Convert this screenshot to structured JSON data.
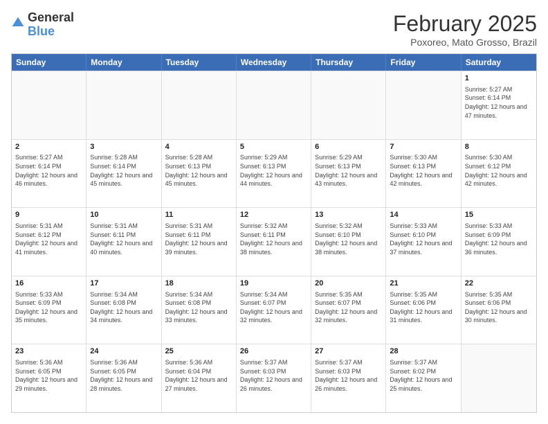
{
  "header": {
    "logo_general": "General",
    "logo_blue": "Blue",
    "month_title": "February 2025",
    "subtitle": "Poxoreo, Mato Grosso, Brazil"
  },
  "weekdays": [
    "Sunday",
    "Monday",
    "Tuesday",
    "Wednesday",
    "Thursday",
    "Friday",
    "Saturday"
  ],
  "rows": [
    [
      {
        "day": "",
        "info": "",
        "empty": true
      },
      {
        "day": "",
        "info": "",
        "empty": true
      },
      {
        "day": "",
        "info": "",
        "empty": true
      },
      {
        "day": "",
        "info": "",
        "empty": true
      },
      {
        "day": "",
        "info": "",
        "empty": true
      },
      {
        "day": "",
        "info": "",
        "empty": true
      },
      {
        "day": "1",
        "info": "Sunrise: 5:27 AM\nSunset: 6:14 PM\nDaylight: 12 hours\nand 47 minutes.",
        "empty": false
      }
    ],
    [
      {
        "day": "2",
        "info": "Sunrise: 5:27 AM\nSunset: 6:14 PM\nDaylight: 12 hours\nand 46 minutes.",
        "empty": false
      },
      {
        "day": "3",
        "info": "Sunrise: 5:28 AM\nSunset: 6:14 PM\nDaylight: 12 hours\nand 45 minutes.",
        "empty": false
      },
      {
        "day": "4",
        "info": "Sunrise: 5:28 AM\nSunset: 6:13 PM\nDaylight: 12 hours\nand 45 minutes.",
        "empty": false
      },
      {
        "day": "5",
        "info": "Sunrise: 5:29 AM\nSunset: 6:13 PM\nDaylight: 12 hours\nand 44 minutes.",
        "empty": false
      },
      {
        "day": "6",
        "info": "Sunrise: 5:29 AM\nSunset: 6:13 PM\nDaylight: 12 hours\nand 43 minutes.",
        "empty": false
      },
      {
        "day": "7",
        "info": "Sunrise: 5:30 AM\nSunset: 6:13 PM\nDaylight: 12 hours\nand 42 minutes.",
        "empty": false
      },
      {
        "day": "8",
        "info": "Sunrise: 5:30 AM\nSunset: 6:12 PM\nDaylight: 12 hours\nand 42 minutes.",
        "empty": false
      }
    ],
    [
      {
        "day": "9",
        "info": "Sunrise: 5:31 AM\nSunset: 6:12 PM\nDaylight: 12 hours\nand 41 minutes.",
        "empty": false
      },
      {
        "day": "10",
        "info": "Sunrise: 5:31 AM\nSunset: 6:11 PM\nDaylight: 12 hours\nand 40 minutes.",
        "empty": false
      },
      {
        "day": "11",
        "info": "Sunrise: 5:31 AM\nSunset: 6:11 PM\nDaylight: 12 hours\nand 39 minutes.",
        "empty": false
      },
      {
        "day": "12",
        "info": "Sunrise: 5:32 AM\nSunset: 6:11 PM\nDaylight: 12 hours\nand 38 minutes.",
        "empty": false
      },
      {
        "day": "13",
        "info": "Sunrise: 5:32 AM\nSunset: 6:10 PM\nDaylight: 12 hours\nand 38 minutes.",
        "empty": false
      },
      {
        "day": "14",
        "info": "Sunrise: 5:33 AM\nSunset: 6:10 PM\nDaylight: 12 hours\nand 37 minutes.",
        "empty": false
      },
      {
        "day": "15",
        "info": "Sunrise: 5:33 AM\nSunset: 6:09 PM\nDaylight: 12 hours\nand 36 minutes.",
        "empty": false
      }
    ],
    [
      {
        "day": "16",
        "info": "Sunrise: 5:33 AM\nSunset: 6:09 PM\nDaylight: 12 hours\nand 35 minutes.",
        "empty": false
      },
      {
        "day": "17",
        "info": "Sunrise: 5:34 AM\nSunset: 6:08 PM\nDaylight: 12 hours\nand 34 minutes.",
        "empty": false
      },
      {
        "day": "18",
        "info": "Sunrise: 5:34 AM\nSunset: 6:08 PM\nDaylight: 12 hours\nand 33 minutes.",
        "empty": false
      },
      {
        "day": "19",
        "info": "Sunrise: 5:34 AM\nSunset: 6:07 PM\nDaylight: 12 hours\nand 32 minutes.",
        "empty": false
      },
      {
        "day": "20",
        "info": "Sunrise: 5:35 AM\nSunset: 6:07 PM\nDaylight: 12 hours\nand 32 minutes.",
        "empty": false
      },
      {
        "day": "21",
        "info": "Sunrise: 5:35 AM\nSunset: 6:06 PM\nDaylight: 12 hours\nand 31 minutes.",
        "empty": false
      },
      {
        "day": "22",
        "info": "Sunrise: 5:35 AM\nSunset: 6:06 PM\nDaylight: 12 hours\nand 30 minutes.",
        "empty": false
      }
    ],
    [
      {
        "day": "23",
        "info": "Sunrise: 5:36 AM\nSunset: 6:05 PM\nDaylight: 12 hours\nand 29 minutes.",
        "empty": false
      },
      {
        "day": "24",
        "info": "Sunrise: 5:36 AM\nSunset: 6:05 PM\nDaylight: 12 hours\nand 28 minutes.",
        "empty": false
      },
      {
        "day": "25",
        "info": "Sunrise: 5:36 AM\nSunset: 6:04 PM\nDaylight: 12 hours\nand 27 minutes.",
        "empty": false
      },
      {
        "day": "26",
        "info": "Sunrise: 5:37 AM\nSunset: 6:03 PM\nDaylight: 12 hours\nand 26 minutes.",
        "empty": false
      },
      {
        "day": "27",
        "info": "Sunrise: 5:37 AM\nSunset: 6:03 PM\nDaylight: 12 hours\nand 26 minutes.",
        "empty": false
      },
      {
        "day": "28",
        "info": "Sunrise: 5:37 AM\nSunset: 6:02 PM\nDaylight: 12 hours\nand 25 minutes.",
        "empty": false
      },
      {
        "day": "",
        "info": "",
        "empty": true
      }
    ]
  ]
}
